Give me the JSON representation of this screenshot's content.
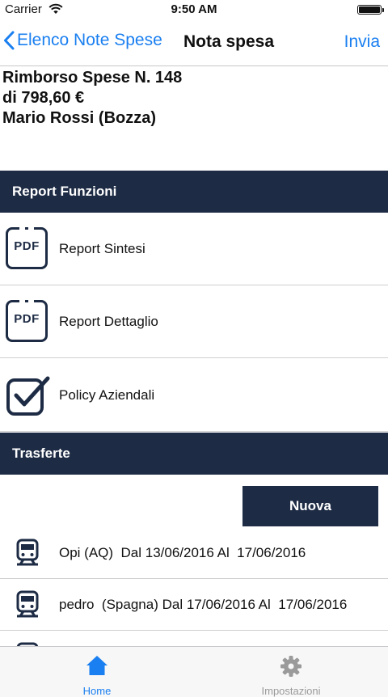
{
  "status_bar": {
    "carrier": "Carrier",
    "time": "9:50 AM"
  },
  "nav": {
    "back_label": "Elenco Note Spese",
    "title": "Nota spesa",
    "action_label": "Invia"
  },
  "summary": {
    "line1": "Rimborso Spese N. 148",
    "line2": "di 798,60 €",
    "line3": "Mario Rossi (Bozza)"
  },
  "report_section": {
    "header": "Report Funzioni",
    "items": [
      {
        "label": "Report Sintesi",
        "icon": "pdf-icon",
        "icon_text": "PDF"
      },
      {
        "label": "Report Dettaglio",
        "icon": "pdf-icon",
        "icon_text": "PDF"
      },
      {
        "label": "Policy Aziendali",
        "icon": "checkbox-icon"
      }
    ]
  },
  "trasferte_section": {
    "header": "Trasferte",
    "new_button": "Nuova",
    "trips": [
      {
        "label": "Opi (AQ)  Dal 13/06/2016 Al  17/06/2016",
        "icon": "train-icon"
      },
      {
        "label": "pedro  (Spagna) Dal 17/06/2016 Al  17/06/2016",
        "icon": "train-icon"
      }
    ]
  },
  "tab_bar": {
    "items": [
      {
        "label": "Home",
        "icon": "home-icon",
        "active": true
      },
      {
        "label": "Impostazioni",
        "icon": "gear-icon",
        "active": false
      }
    ]
  },
  "colors": {
    "accent": "#1a7ff0",
    "header_bg": "#1d2b44",
    "tab_inactive": "#9a9a9a"
  }
}
